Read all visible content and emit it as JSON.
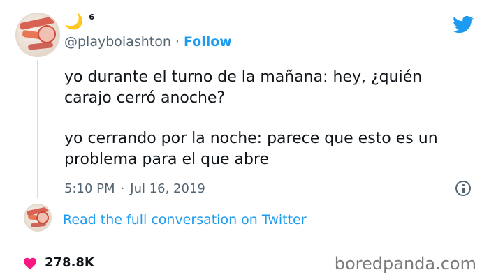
{
  "tweet": {
    "display_suffix": "6",
    "handle": "@playboiashton",
    "separator": "·",
    "follow_label": "Follow",
    "text_paragraphs": [
      "yo durante el turno de la mañana: hey, ¿quién carajo cerró anoche?",
      "yo cerrando por la noche: parece que esto es un problema para el que abre"
    ],
    "time": "5:10 PM",
    "date": "Jul 16, 2019",
    "read_link": "Read the full conversation on Twitter",
    "likes": "278.8K"
  },
  "icons": {
    "moon": "crescent-moon-icon",
    "bird": "twitter-bird-icon",
    "info": "info-icon",
    "heart": "heart-icon"
  },
  "colors": {
    "twitter_blue": "#1d9bf0",
    "heart_red": "#f91880",
    "muted": "#536471"
  },
  "watermark": "boredpanda.com"
}
